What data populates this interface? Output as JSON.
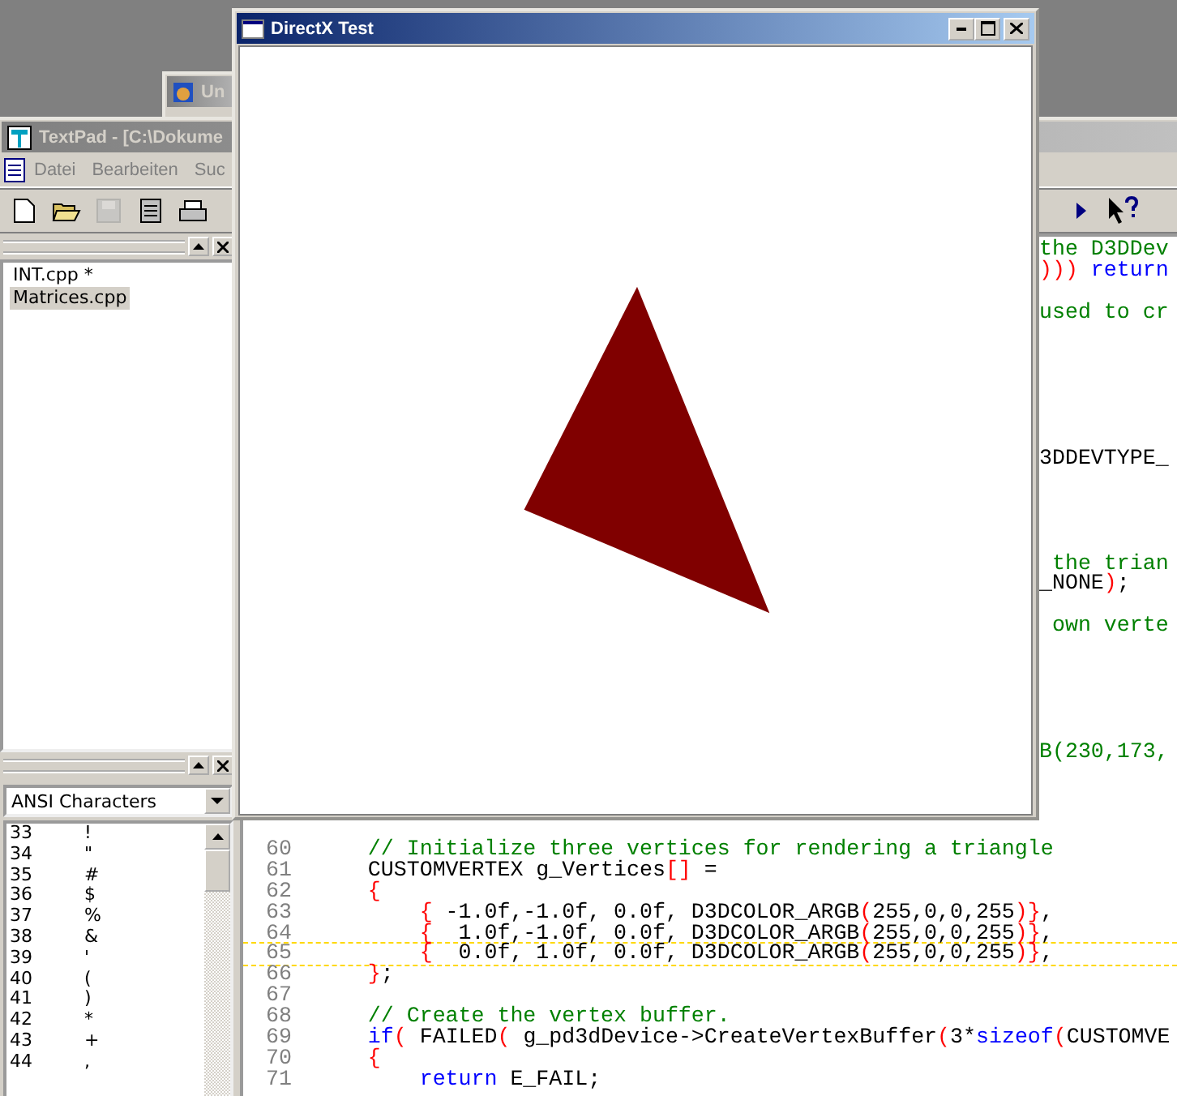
{
  "background_window": {
    "title": "Un"
  },
  "textpad": {
    "title": "TextPad - [C:\\Dokume",
    "menu": [
      "Datei",
      "Bearbeiten",
      "Suc"
    ],
    "toolbar": [
      {
        "kind": "new",
        "disabled": false
      },
      {
        "kind": "open",
        "disabled": false
      },
      {
        "kind": "save",
        "disabled": true
      },
      {
        "kind": "clipboard",
        "disabled": false
      },
      {
        "kind": "print",
        "disabled": false
      }
    ],
    "toolbar_right": [
      {
        "kind": "play"
      },
      {
        "kind": "help"
      }
    ],
    "documents": [
      {
        "name": "INT.cpp *",
        "selected": false
      },
      {
        "name": "Matrices.cpp",
        "selected": true
      }
    ],
    "char_panel": {
      "charset": "ANSI Characters",
      "rows": [
        {
          "code": "33",
          "char": "!"
        },
        {
          "code": "34",
          "char": "\""
        },
        {
          "code": "35",
          "char": "#"
        },
        {
          "code": "36",
          "char": "$"
        },
        {
          "code": "37",
          "char": "%"
        },
        {
          "code": "38",
          "char": "&"
        },
        {
          "code": "39",
          "char": "'"
        },
        {
          "code": "40",
          "char": "("
        },
        {
          "code": "41",
          "char": ")"
        },
        {
          "code": "42",
          "char": "*"
        },
        {
          "code": "43",
          "char": "+"
        },
        {
          "code": "44",
          "char": ","
        }
      ]
    },
    "editor": {
      "fragments": [
        [
          {
            "kind": "comment",
            "text": "the D3DDev"
          }
        ],
        [
          {
            "kind": "bracket",
            "text": ")))"
          },
          {
            "kind": "keyword",
            "text": " return"
          }
        ],
        [
          {
            "kind": "comment",
            "text": "used to cr"
          }
        ],
        [
          {
            "kind": "plain",
            "text": "3DDEVTYPE_"
          }
        ],
        [
          {
            "kind": "comment",
            "text": " the trian"
          }
        ],
        [
          {
            "kind": "plain",
            "text": "_NONE"
          },
          {
            "kind": "bracket",
            "text": ")"
          },
          {
            "kind": "plain",
            "text": ";"
          }
        ],
        [
          {
            "kind": "comment",
            "text": " own verte"
          }
        ],
        [
          {
            "kind": "comment",
            "text": "B(230,173,"
          }
        ]
      ],
      "lines": [
        {
          "number": "60",
          "current": false,
          "segments": [
            {
              "kind": "comment",
              "text": "    // Initialize three vertices for rendering a triangle"
            }
          ]
        },
        {
          "number": "61",
          "current": false,
          "segments": [
            {
              "kind": "plain",
              "text": "    CUSTOMVERTEX g_Vertices"
            },
            {
              "kind": "bracket",
              "text": "[]"
            },
            {
              "kind": "plain",
              "text": " ="
            }
          ]
        },
        {
          "number": "62",
          "current": false,
          "segments": [
            {
              "kind": "bracket",
              "text": "    {"
            }
          ]
        },
        {
          "number": "63",
          "current": false,
          "segments": [
            {
              "kind": "bracket",
              "text": "        {"
            },
            {
              "kind": "plain",
              "text": " -1.0f,-1.0f, 0.0f, D3DCOLOR_ARGB"
            },
            {
              "kind": "bracket",
              "text": "("
            },
            {
              "kind": "plain",
              "text": "255,0,0,255"
            },
            {
              "kind": "bracket",
              "text": ")}"
            },
            {
              "kind": "plain",
              "text": ","
            }
          ]
        },
        {
          "number": "64",
          "current": false,
          "segments": [
            {
              "kind": "bracket",
              "text": "        {"
            },
            {
              "kind": "plain",
              "text": "  1.0f,-1.0f, 0.0f, D3DCOLOR_ARGB"
            },
            {
              "kind": "bracket",
              "text": "("
            },
            {
              "kind": "plain",
              "text": "255,0,0,255"
            },
            {
              "kind": "bracket",
              "text": ")}"
            },
            {
              "kind": "plain",
              "text": ","
            }
          ]
        },
        {
          "number": "65",
          "current": true,
          "segments": [
            {
              "kind": "bracket",
              "text": "        {"
            },
            {
              "kind": "plain",
              "text": "  0.0f, 1.0f, 0.0f, D3DCOLOR_ARGB"
            },
            {
              "kind": "bracket",
              "text": "("
            },
            {
              "kind": "plain",
              "text": "255,0,0,255"
            },
            {
              "kind": "bracket",
              "text": ")}"
            },
            {
              "kind": "plain",
              "text": ","
            }
          ]
        },
        {
          "number": "66",
          "current": false,
          "segments": [
            {
              "kind": "bracket",
              "text": "    }"
            },
            {
              "kind": "plain",
              "text": ";"
            }
          ]
        },
        {
          "number": "67",
          "current": false
        },
        {
          "number": "68",
          "current": false,
          "segments": [
            {
              "kind": "comment",
              "text": "    // Create the vertex buffer."
            }
          ]
        },
        {
          "number": "69",
          "current": false,
          "segments": [
            {
              "kind": "keyword",
              "text": "    if"
            },
            {
              "kind": "bracket",
              "text": "("
            },
            {
              "kind": "plain",
              "text": " FAILED"
            },
            {
              "kind": "bracket",
              "text": "("
            },
            {
              "kind": "plain",
              "text": " g_pd3dDevice->CreateVertexBuffer"
            },
            {
              "kind": "bracket",
              "text": "("
            },
            {
              "kind": "plain",
              "text": "3*"
            },
            {
              "kind": "keyword",
              "text": "sizeof"
            },
            {
              "kind": "bracket",
              "text": "("
            },
            {
              "kind": "plain",
              "text": "CUSTOMVE"
            }
          ]
        },
        {
          "number": "70",
          "current": false,
          "segments": [
            {
              "kind": "bracket",
              "text": "    {"
            }
          ]
        },
        {
          "number": "71",
          "current": false,
          "segments": [
            {
              "kind": "keyword",
              "text": "        return"
            },
            {
              "kind": "plain",
              "text": " E_FAIL;"
            }
          ]
        }
      ]
    }
  },
  "dx_window": {
    "title": "DirectX Test"
  }
}
